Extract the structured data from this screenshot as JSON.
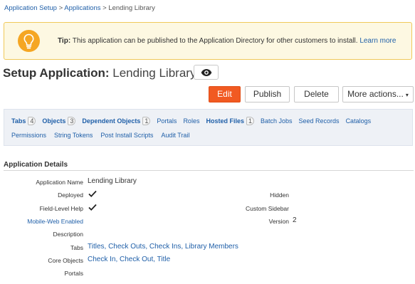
{
  "breadcrumb": {
    "item1": "Application Setup",
    "sep1": " > ",
    "item2": "Applications",
    "sep2": " > ",
    "item3": "Lending Library"
  },
  "tip": {
    "icon": "lightbulb-icon",
    "label": "Tip:",
    "text": " This application can be published to the Application Directory for other customers to install. ",
    "link": "Learn more"
  },
  "header": {
    "title_label": "Setup Application:",
    "app_name": " Lending Library",
    "view_icon": "eye-icon"
  },
  "toolbar": {
    "edit": "Edit",
    "publish": "Publish",
    "delete": "Delete",
    "more": "More actions...",
    "more_caret": "▾",
    "accent_color": "#f15a22"
  },
  "tabs_row1": [
    {
      "label": "Tabs",
      "count": "4",
      "bold": true
    },
    {
      "label": "Objects",
      "count": "3",
      "bold": true
    },
    {
      "label": "Dependent Objects",
      "count": "1",
      "bold": true
    },
    {
      "label": "Portals",
      "bold": false
    },
    {
      "label": "Roles",
      "bold": false
    },
    {
      "label": "Hosted Files",
      "count": "1",
      "bold": true
    },
    {
      "label": "Batch Jobs",
      "bold": false
    },
    {
      "label": "Seed Records",
      "bold": false
    },
    {
      "label": "Catalogs",
      "bold": false
    }
  ],
  "tabs_row2": [
    {
      "label": "Permissions"
    },
    {
      "label": "String Tokens"
    },
    {
      "label": "Post Install Scripts"
    },
    {
      "label": "Audit Trail"
    }
  ],
  "details": {
    "section_title": "Application Details",
    "app_name_label": "Application Name",
    "app_name_value": "Lending Library",
    "deployed_label": "Deployed",
    "field_level_help_label": "Field-Level Help",
    "mobile_web_label": "Mobile-Web Enabled",
    "description_label": "Description",
    "tabs_label": "Tabs",
    "tabs_value": "Titles, Check Outs, Check Ins, Library Members",
    "core_objects_label": "Core Objects",
    "core_objects_value": "Check In, Check Out, Title",
    "portals_label": "Portals",
    "hidden_label": "Hidden",
    "custom_sidebar_label": "Custom Sidebar",
    "version_label": "Version",
    "version_value": "2",
    "check_icon": "checkmark-icon"
  }
}
